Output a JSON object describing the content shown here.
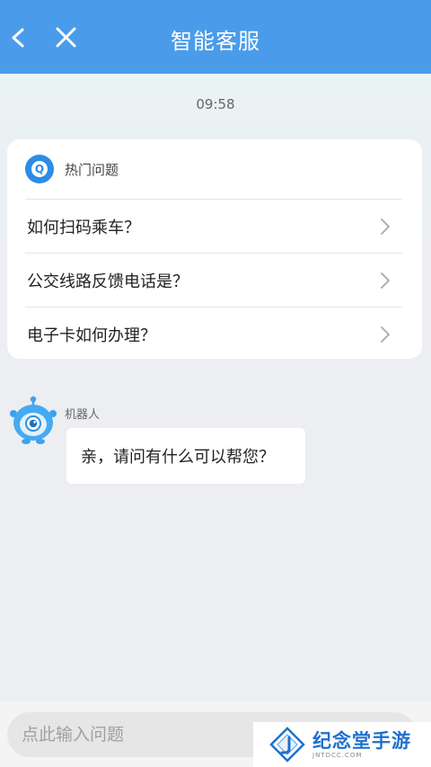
{
  "header": {
    "title": "智能客服",
    "back_icon": "chevron-left-icon",
    "close_icon": "close-icon",
    "background_color": "#4a9cea"
  },
  "chat": {
    "timestamp": "09:58",
    "hot_questions": {
      "heading": "热门问题",
      "icon": "q-badge-icon",
      "items": [
        {
          "label": "如何扫码乘车？"
        },
        {
          "label": "公交线路反馈电话是？"
        },
        {
          "label": "电子卡如何办理？"
        }
      ]
    },
    "bot_message": {
      "sender": "机器人",
      "text": "亲，请问有什么可以帮您？",
      "avatar_icon": "robot-avatar-icon"
    }
  },
  "composer": {
    "placeholder": "点此输入问题",
    "value": ""
  },
  "watermark": {
    "brand": "纪念堂手游",
    "sub": "JNTDCC.COM"
  }
}
